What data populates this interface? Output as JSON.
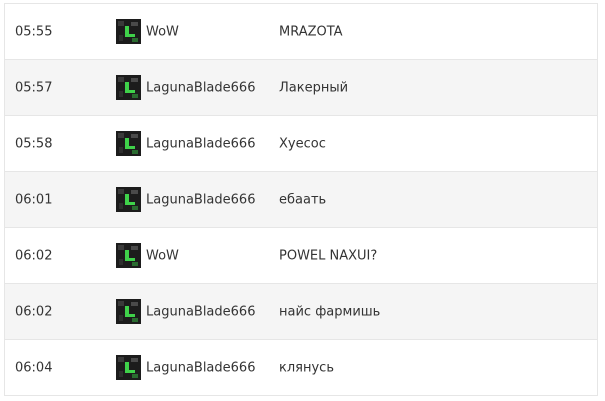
{
  "chat": {
    "rows": [
      {
        "time": "05:55",
        "player": "WoW",
        "message": "MRAZOTA",
        "avatar_icon": "hero-portrait-icon"
      },
      {
        "time": "05:57",
        "player": "LagunaBlade666",
        "message": "Лакерный",
        "avatar_icon": "hero-portrait-icon"
      },
      {
        "time": "05:58",
        "player": "LagunaBlade666",
        "message": "Хуесос",
        "avatar_icon": "hero-portrait-icon"
      },
      {
        "time": "06:01",
        "player": "LagunaBlade666",
        "message": "ебаать",
        "avatar_icon": "hero-portrait-icon"
      },
      {
        "time": "06:02",
        "player": "WoW",
        "message": "POWEL NAXUI?",
        "avatar_icon": "hero-portrait-icon"
      },
      {
        "time": "06:02",
        "player": "LagunaBlade666",
        "message": "найс фармишь",
        "avatar_icon": "hero-portrait-icon"
      },
      {
        "time": "06:04",
        "player": "LagunaBlade666",
        "message": "клянусь",
        "avatar_icon": "hero-portrait-icon"
      }
    ]
  },
  "colors": {
    "row_alt_background": "#f5f5f5",
    "row_background": "#ffffff",
    "divider": "#e6e6e6",
    "text": "#333333",
    "avatar_accent": "#3fd14a"
  }
}
